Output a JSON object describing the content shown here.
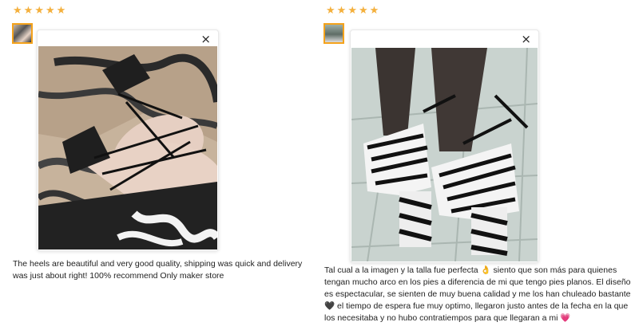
{
  "reviews": [
    {
      "rating": 5,
      "text": "The heels are beautiful and very good quality, shipping was quick and delivery was just about right! 100% recommend Only maker store",
      "close_icon": "×"
    },
    {
      "rating": 5,
      "text": "Tal cual a la imagen y la talla fue perfecta 👌 siento que son más para quienes tengan mucho arco en los pies a diferencia de mi que tengo pies planos. El diseño es espectacular, se sienten de muy buena calidad y me los han chuleado bastante 🖤 el tiempo de espera fue muy optimo, llegaron justo antes de la fecha en la que los necesitaba y no hubo contratiempos para que llegaran a mi 💗",
      "close_icon": "×"
    }
  ],
  "icons": {
    "star": "star-icon",
    "close": "close-icon"
  },
  "colors": {
    "star": "#f4b03d",
    "thumb_border": "#f4a21b"
  }
}
